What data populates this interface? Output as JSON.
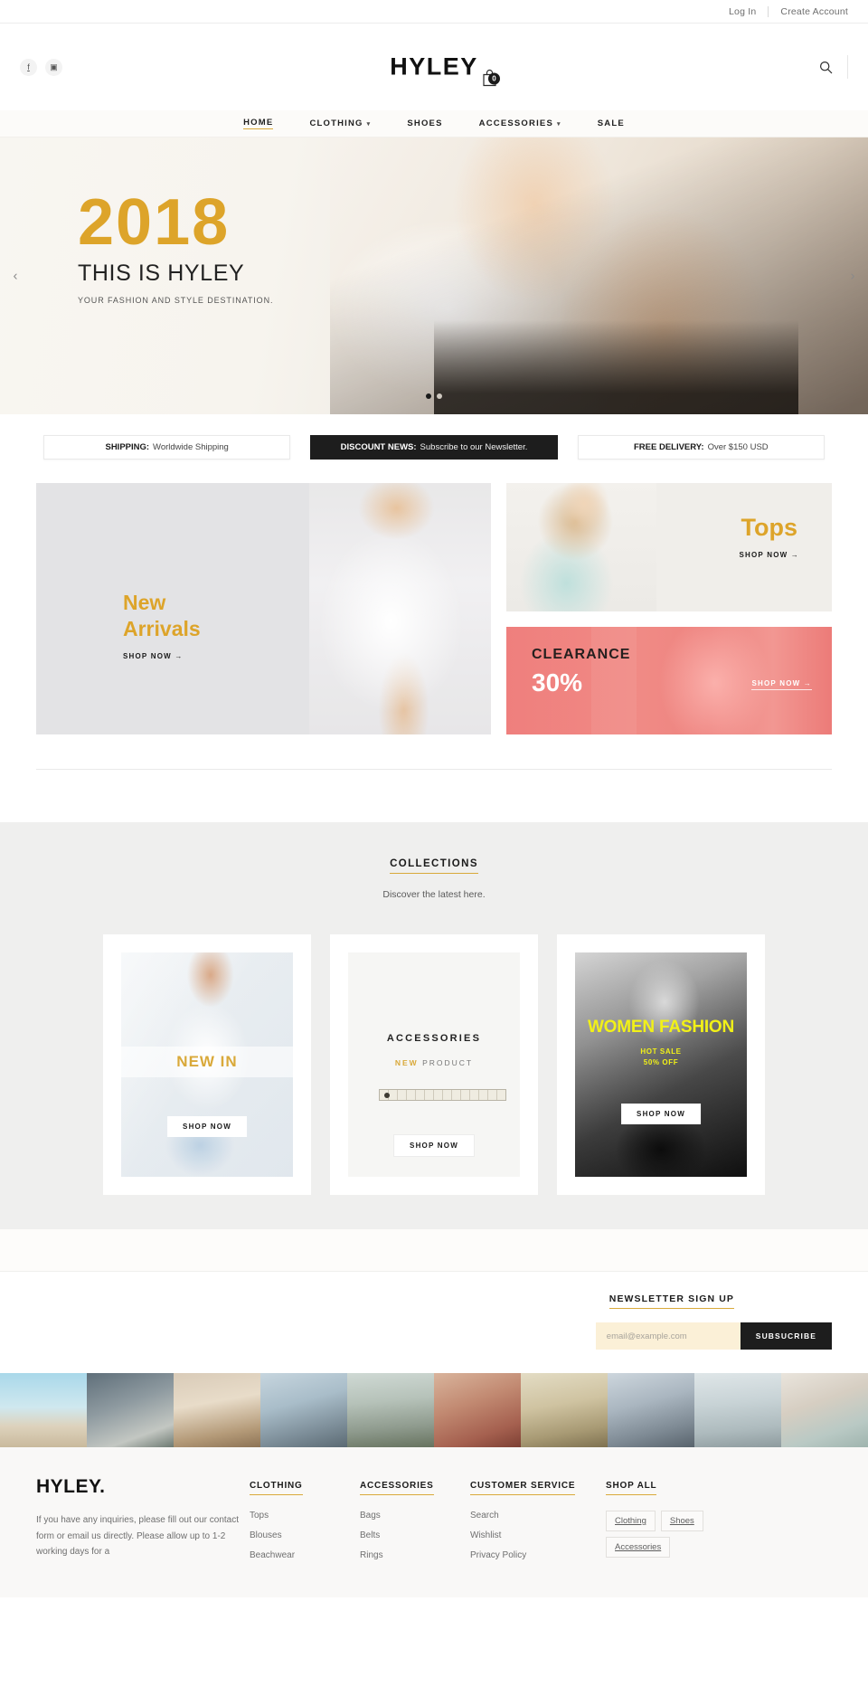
{
  "topbar": {
    "login": "Log In",
    "create_account": "Create Account"
  },
  "header": {
    "logo": "HYLEY",
    "social": [
      {
        "name": "facebook-icon",
        "glyph": "f"
      },
      {
        "name": "instagram-icon",
        "glyph": "▣"
      }
    ],
    "cart_count": "0",
    "search_icon": "search-icon"
  },
  "nav": [
    {
      "label": "HOME",
      "active": true,
      "caret": false
    },
    {
      "label": "CLOTHING",
      "active": false,
      "caret": true
    },
    {
      "label": "SHOES",
      "active": false,
      "caret": false
    },
    {
      "label": "ACCESSORIES",
      "active": false,
      "caret": true
    },
    {
      "label": "SALE",
      "active": false,
      "caret": false
    }
  ],
  "hero": {
    "year": "2018",
    "title": "THIS IS HYLEY",
    "subtitle": "YOUR FASHION AND STYLE DESTINATION.",
    "prev": "‹",
    "next": "›",
    "slides": 2,
    "active_slide": 1
  },
  "promos": [
    {
      "strong": "SHIPPING:",
      "text": "Worldwide Shipping",
      "dark": false
    },
    {
      "strong": "DISCOUNT NEWS:",
      "text": "Subscribe to our Newsletter.",
      "dark": true
    },
    {
      "strong": "FREE DELIVERY:",
      "text": "Over $150 USD",
      "dark": false
    }
  ],
  "banners": {
    "new_arrivals": {
      "line1": "New",
      "line2": "Arrivals",
      "cta": "SHOP NOW  →"
    },
    "tops": {
      "title": "Tops",
      "cta": "SHOP NOW  →"
    },
    "clearance": {
      "title": "CLEARANCE",
      "percent": "30%",
      "cta": "SHOP NOW  →"
    }
  },
  "collections": {
    "title": "COLLECTIONS",
    "subtitle": "Discover the latest here.",
    "cards": [
      {
        "badge": "NEW IN",
        "cta": "SHOP NOW"
      },
      {
        "title": "ACCESSORIES",
        "sub_accent": "NEW",
        "sub_rest": "PRODUCT",
        "cta": "SHOP NOW"
      },
      {
        "title": "WOMEN FASHION",
        "sub1": "HOT SALE",
        "sub2": "50% OFF",
        "cta": "SHOP NOW"
      }
    ]
  },
  "newsletter": {
    "title": "NEWSLETTER SIGN UP",
    "placeholder": "email@example.com",
    "value": "",
    "button": "SUBSUCRIBE"
  },
  "footer": {
    "logo": "HYLEY.",
    "description": "If you have any inquiries, please fill out our contact form or email us directly. Please allow up to 1-2 working days for a",
    "columns": [
      {
        "head": "CLOTHING",
        "links": [
          "Tops",
          "Blouses",
          "Beachwear"
        ]
      },
      {
        "head": "ACCESSORIES",
        "links": [
          "Bags",
          "Belts",
          "Rings"
        ]
      },
      {
        "head": "CUSTOMER SERVICE",
        "links": [
          "Search",
          "Wishlist",
          "Privacy Policy"
        ]
      }
    ],
    "shop_all": {
      "head": "SHOP ALL",
      "tags": [
        "Clothing",
        "Shoes",
        "Accessories"
      ]
    }
  },
  "colors": {
    "gold": "#d9a93a",
    "hero_gold": "#dda42a",
    "dark": "#1d1d1d",
    "clearance_pink": "#f0827e",
    "yellow": "#f2f117",
    "newsletter_bg": "#fbf0d7"
  }
}
